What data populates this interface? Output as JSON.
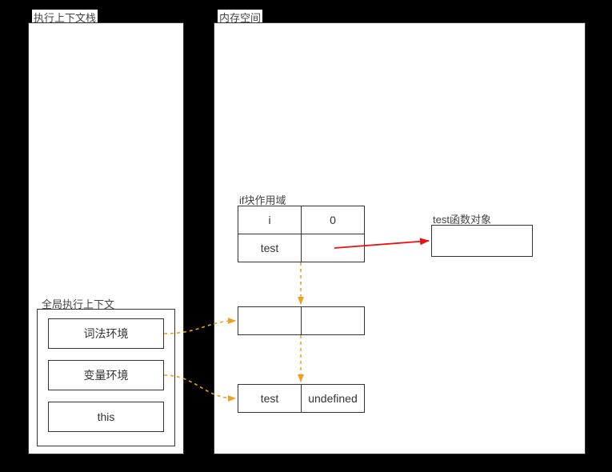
{
  "stack": {
    "title": "执行上下文栈",
    "global_ctx": {
      "title": "全局执行上下文",
      "lexical": "词法环境",
      "variable": "变量环境",
      "this_label": "this"
    }
  },
  "memory": {
    "title": "内存空间",
    "if_scope": {
      "label": "if块作用域",
      "rows": [
        {
          "key": "i",
          "value": "0"
        },
        {
          "key": "test",
          "value": ""
        }
      ]
    },
    "empty_env": {
      "key": "",
      "value": ""
    },
    "var_env_row": {
      "key": "test",
      "value": "undefined"
    },
    "func_obj": {
      "label": "test函数对象"
    }
  }
}
